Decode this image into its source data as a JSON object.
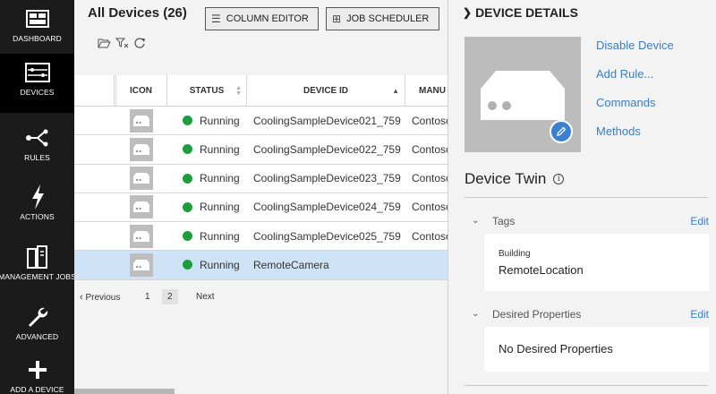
{
  "nav": [
    {
      "label": "DASHBOARD",
      "icon": "dashboard-icon"
    },
    {
      "label": "DEVICES",
      "icon": "devices-icon"
    },
    {
      "label": "RULES",
      "icon": "rules-icon"
    },
    {
      "label": "ACTIONS",
      "icon": "actions-icon"
    },
    {
      "label": "MANAGEMENT JOBS",
      "icon": "management-jobs-icon"
    },
    {
      "label": "ADVANCED",
      "icon": "wrench-icon"
    },
    {
      "label": "ADD A DEVICE",
      "icon": "plus-icon"
    }
  ],
  "grid": {
    "title": "All Devices (26)",
    "column_editor": "COLUMN EDITOR",
    "job_scheduler": "JOB SCHEDULER",
    "columns": {
      "icon": "ICON",
      "status": "STATUS",
      "device_id": "DEVICE ID",
      "manufacturer": "MANU"
    },
    "rows": [
      {
        "status": "Running",
        "device_id": "CoolingSampleDevice021_759",
        "manufacturer": "Contoso"
      },
      {
        "status": "Running",
        "device_id": "CoolingSampleDevice022_759",
        "manufacturer": "Contoso"
      },
      {
        "status": "Running",
        "device_id": "CoolingSampleDevice023_759",
        "manufacturer": "Contoso"
      },
      {
        "status": "Running",
        "device_id": "CoolingSampleDevice024_759",
        "manufacturer": "Contoso"
      },
      {
        "status": "Running",
        "device_id": "CoolingSampleDevice025_759",
        "manufacturer": "Contoso"
      },
      {
        "status": "Running",
        "device_id": "RemoteCamera",
        "manufacturer": ""
      }
    ],
    "pager": {
      "previous": "Previous",
      "page1": "1",
      "page2": "2",
      "next": "Next"
    }
  },
  "details": {
    "header": "DEVICE DETAILS",
    "links": [
      "Disable Device",
      "Add Rule...",
      "Commands",
      "Methods"
    ],
    "twin_title": "Device Twin",
    "tags": {
      "label": "Tags",
      "edit": "Edit",
      "key": "Building",
      "value": "RemoteLocation"
    },
    "desired": {
      "label": "Desired Properties",
      "edit": "Edit",
      "value": "No Desired Properties"
    }
  },
  "colors": {
    "accent": "#3a7ec6",
    "status_running": "#1e9e3b",
    "selected_row": "#cfe3f7",
    "nav_bg": "#1b1b1b"
  }
}
